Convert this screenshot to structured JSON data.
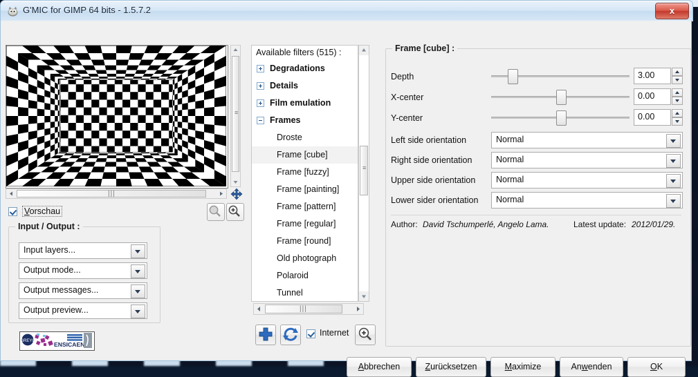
{
  "window": {
    "title": "G'MIC for GIMP 64 bits - 1.5.7.2",
    "close_label": "x",
    "app_icon": "gimp-wilber-icon"
  },
  "preview": {
    "checkbox_label": "Vorschau",
    "checkbox_checked": true,
    "zoom_out_icon": "magnifier-minus-icon",
    "zoom_in_icon": "magnifier-plus-icon",
    "pan_icon": "move-cross-icon"
  },
  "input_output": {
    "legend": "Input / Output :",
    "selects": [
      {
        "value": "Input layers...",
        "name": "input-layers-select"
      },
      {
        "value": "Output mode...",
        "name": "output-mode-select"
      },
      {
        "value": "Output messages...",
        "name": "output-messages-select"
      },
      {
        "value": "Output preview...",
        "name": "output-preview-select"
      }
    ],
    "logo_text": "ENSICAEN"
  },
  "filters": {
    "header": "Available filters (515) :",
    "tree": [
      {
        "label": "Degradations",
        "type": "category",
        "expanded": false
      },
      {
        "label": "Details",
        "type": "category",
        "expanded": false
      },
      {
        "label": "Film emulation",
        "type": "category",
        "expanded": false
      },
      {
        "label": "Frames",
        "type": "category",
        "expanded": true
      },
      {
        "label": "Droste",
        "type": "leaf",
        "selected": false
      },
      {
        "label": "Frame [cube]",
        "type": "leaf",
        "selected": true
      },
      {
        "label": "Frame [fuzzy]",
        "type": "leaf",
        "selected": false
      },
      {
        "label": "Frame [painting]",
        "type": "leaf",
        "selected": false
      },
      {
        "label": "Frame [pattern]",
        "type": "leaf",
        "selected": false
      },
      {
        "label": "Frame [regular]",
        "type": "leaf",
        "selected": false
      },
      {
        "label": "Frame [round]",
        "type": "leaf",
        "selected": false
      },
      {
        "label": "Old photograph",
        "type": "leaf",
        "selected": false
      },
      {
        "label": "Polaroid",
        "type": "leaf",
        "selected": false
      },
      {
        "label": "Tunnel",
        "type": "leaf",
        "selected": false
      }
    ],
    "toolbar": {
      "add_icon": "plus-icon",
      "refresh_icon": "refresh-icon",
      "internet_label": "Internet",
      "internet_checked": true,
      "search_icon": "magnifier-plus-icon"
    }
  },
  "params": {
    "legend": "Frame [cube] :",
    "sliders": [
      {
        "label": "Depth",
        "value": "3.00",
        "fraction": 0.13
      },
      {
        "label": "X-center",
        "value": "0.00",
        "fraction": 0.5
      },
      {
        "label": "Y-center",
        "value": "0.00",
        "fraction": 0.5
      }
    ],
    "dropdowns": [
      {
        "label": "Left side orientation",
        "value": "Normal"
      },
      {
        "label": "Right side orientation",
        "value": "Normal"
      },
      {
        "label": "Upper side orientation",
        "value": "Normal"
      },
      {
        "label": "Lower sider orientation",
        "value": "Normal"
      }
    ],
    "author_prefix": "Author:",
    "author_names": "David Tschumperlé, Angelo Lama.",
    "update_prefix": "Latest update:",
    "update_date": "2012/01/29."
  },
  "buttons": {
    "cancel": {
      "pre": "",
      "key": "A",
      "post": "bbrechen"
    },
    "reset": {
      "pre": "",
      "key": "Z",
      "post": "urücksetzen"
    },
    "maximize": {
      "pre": "",
      "key": "M",
      "post": "aximize"
    },
    "apply": {
      "pre": "An",
      "key": "w",
      "post": "enden"
    },
    "ok": {
      "pre": "",
      "key": "O",
      "post": "K"
    }
  },
  "colors": {
    "accent_blue": "#1d4e85",
    "close_red": "#c23a2c",
    "window_bg": "#f0f0f0",
    "selection": "#f2f2f2"
  }
}
